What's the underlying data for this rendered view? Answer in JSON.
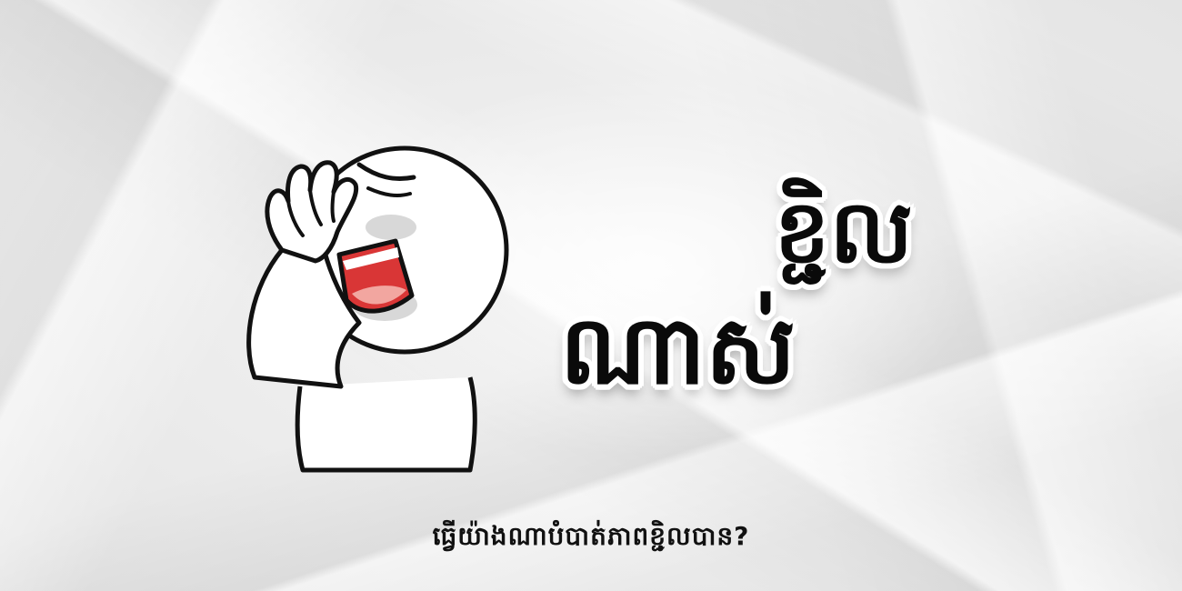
{
  "title": {
    "line1": "ខ្ជិល",
    "line2": "ណាស់"
  },
  "question": "ធ្វើយ៉ាងណាបំបាត់ភាពខ្ជិលបាន?",
  "illustration": {
    "icon": "facepalm-character-icon",
    "colors": {
      "outline": "#111111",
      "body": "#ffffff",
      "mouth": "#d93636",
      "tongue": "#f2a6a0",
      "shadow": "#d8d8d8"
    }
  }
}
